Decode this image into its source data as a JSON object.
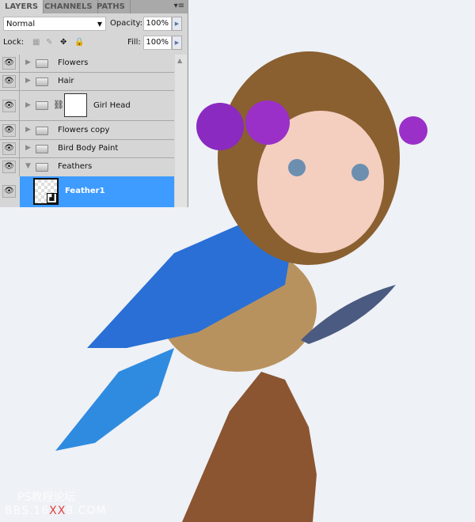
{
  "layers_panel": {
    "tabs": [
      "LAYERS",
      "CHANNELS",
      "PATHS"
    ],
    "active_tab": "LAYERS",
    "blend_mode": "Normal",
    "opacity_label": "Opacity:",
    "opacity": "100%",
    "lock_label": "Lock:",
    "fill_label": "Fill:",
    "fill": "100%",
    "layers": [
      {
        "name": "Flowers",
        "type": "group",
        "expanded": false,
        "visible": true
      },
      {
        "name": "Hair",
        "type": "group",
        "expanded": false,
        "visible": true
      },
      {
        "name": "Girl Head",
        "type": "group",
        "expanded": false,
        "visible": true,
        "mask": true
      },
      {
        "name": "Flowers copy",
        "type": "group",
        "expanded": false,
        "visible": true
      },
      {
        "name": "Bird Body Paint",
        "type": "group",
        "expanded": false,
        "visible": true
      },
      {
        "name": "Feathers",
        "type": "group",
        "expanded": true,
        "visible": true
      },
      {
        "name": "Feather1",
        "type": "smart-object",
        "visible": true,
        "selected": true
      }
    ],
    "selection_color": "#3e9bff"
  },
  "watermark": {
    "line1": "PS教程论坛",
    "line2_a": "BBS.16",
    "line2_b": "XX",
    "line2_c": "8.COM"
  }
}
